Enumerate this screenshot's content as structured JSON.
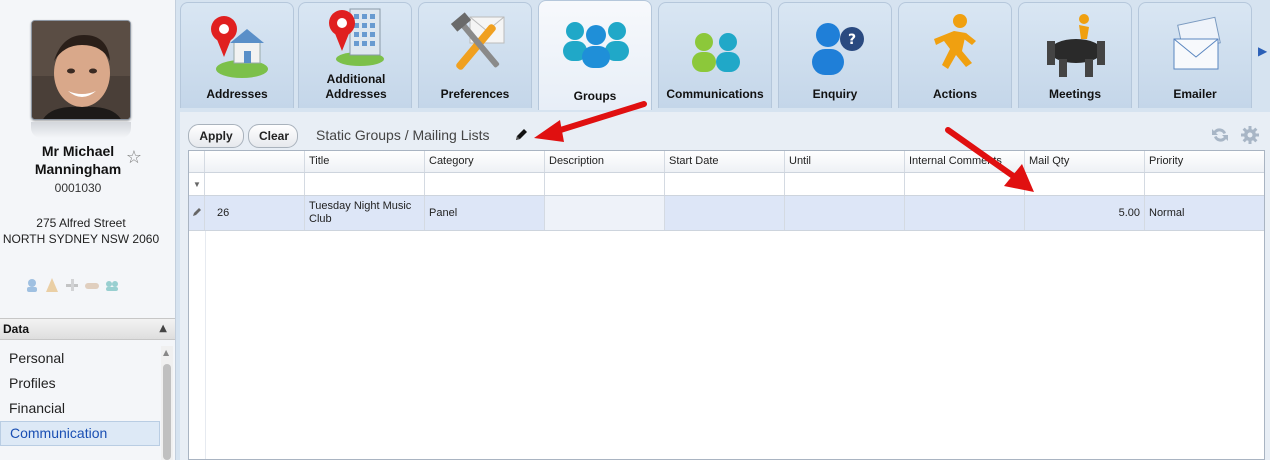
{
  "profile": {
    "name": "Mr Michael Manningham",
    "id": "0001030",
    "address_line1": "275 Alfred Street",
    "address_line2": "NORTH SYDNEY NSW 2060"
  },
  "data_panel": {
    "title": "Data",
    "items": [
      {
        "label": "Personal",
        "active": false
      },
      {
        "label": "Profiles",
        "active": false
      },
      {
        "label": "Financial",
        "active": false
      },
      {
        "label": "Communication",
        "active": true
      }
    ]
  },
  "tabs": [
    {
      "label": "Addresses",
      "icon": "address-pin-house-icon",
      "active": false
    },
    {
      "label": "Additional Addresses",
      "icon": "address-pin-building-icon",
      "active": false
    },
    {
      "label": "Preferences",
      "icon": "hammer-screwdriver-icon",
      "active": false
    },
    {
      "label": "Groups",
      "icon": "people-group-icon",
      "active": true
    },
    {
      "label": "Communications",
      "icon": "people-pair-icon",
      "active": false
    },
    {
      "label": "Enquiry",
      "icon": "person-question-icon",
      "active": false
    },
    {
      "label": "Actions",
      "icon": "running-person-icon",
      "active": false
    },
    {
      "label": "Meetings",
      "icon": "meeting-table-icon",
      "active": false
    },
    {
      "label": "Emailer",
      "icon": "envelope-stack-icon",
      "active": false
    }
  ],
  "toolbar": {
    "apply_label": "Apply",
    "clear_label": "Clear",
    "title": "Static Groups / Mailing Lists"
  },
  "grid": {
    "columns": [
      "",
      "Title",
      "Category",
      "Description",
      "Start Date",
      "Until",
      "Internal Comments",
      "Mail Qty",
      "Priority"
    ],
    "rows": [
      {
        "id": "26",
        "title": "Tuesday Night Music Club",
        "category": "Panel",
        "description": "",
        "start_date": "",
        "until": "",
        "internal_comments": "",
        "mail_qty": "5.00",
        "priority": "Normal"
      }
    ]
  },
  "colors": {
    "accent": "#1a4fb3",
    "selected_row": "#dde6f7",
    "annotation_arrow": "#e01010"
  }
}
